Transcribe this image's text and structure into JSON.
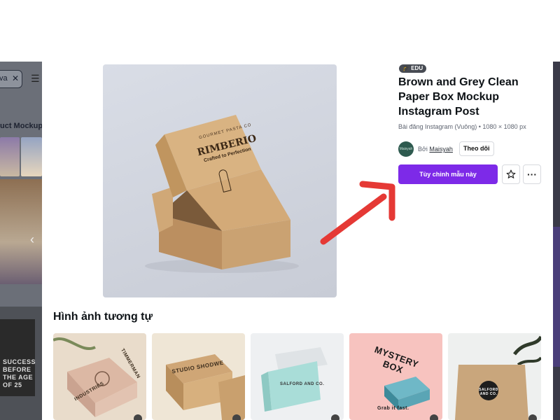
{
  "background_page": {
    "chip_text": "va",
    "title_fragment": "uct Mockups",
    "dark_card_text": "SUCCESS BEFORE THE AGE OF 25"
  },
  "template": {
    "badge": "EDU",
    "title": "Brown and Grey Clean Paper Box Mockup Instagram Post",
    "subtitle": "Bài đăng Instagram (Vuông) • 1080 × 1080 px",
    "author_prefix": "Bởi",
    "author_name": "Maisyah",
    "avatar_text": "Maisyah",
    "follow_label": "Theo dõi",
    "customize_label": "Tùy chỉnh mẫu này",
    "box_brand": "RIMBERIO",
    "box_tagline": "Crafted to Perfection",
    "box_top_text": "GOURMET PASTA CO"
  },
  "similar": {
    "heading": "Hình ảnh tương tự",
    "items": [
      {
        "label": "INDUSTRIES",
        "label2": "TIMMERMAN",
        "bg": "#e8d6c4"
      },
      {
        "label": "STUDIO SHODWE",
        "bg": "#efe7d8"
      },
      {
        "label": "SALFORD AND CO.",
        "bg": "#eef1f3"
      },
      {
        "label": "MYSTERY BOX",
        "label2": "Grab it fast.",
        "bg": "#f6c1bd"
      },
      {
        "label": "SALFORD AND CO.",
        "bg": "#eef0ef"
      }
    ]
  },
  "colors": {
    "primary": "#7d2ae8",
    "annotation_arrow": "#e53935"
  }
}
